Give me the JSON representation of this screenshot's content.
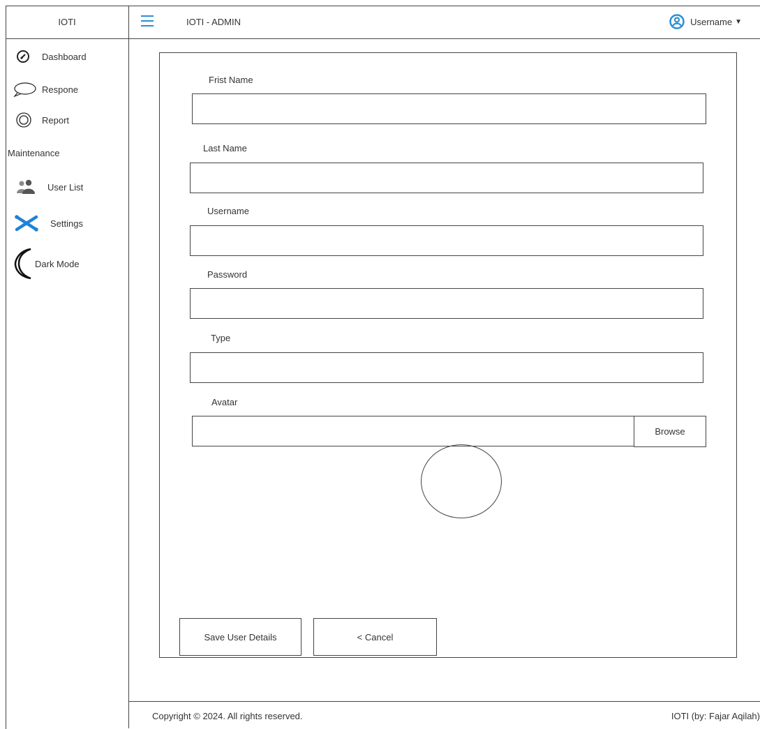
{
  "brand": "IOTI",
  "header": {
    "title": "IOTI - ADMIN",
    "username": "Username",
    "accent": "#2a8fd6"
  },
  "sidebar": {
    "items": [
      {
        "label": "Dashboard",
        "icon": "speedometer-icon"
      },
      {
        "label": "Respone",
        "icon": "speech-bubble-icon"
      },
      {
        "label": "Report",
        "icon": "target-circle-icon"
      }
    ],
    "section": "Maintenance",
    "maintenance_items": [
      {
        "label": "User List",
        "icon": "users-icon"
      },
      {
        "label": "Settings",
        "icon": "cross-tools-icon"
      },
      {
        "label": "Dark Mode",
        "icon": "crescent-moon-icon"
      }
    ]
  },
  "form": {
    "first_name_label": "Frist Name",
    "last_name_label": "Last Name",
    "username_label": "Username",
    "password_label": "Password",
    "type_label": "Type",
    "avatar_label": "Avatar",
    "browse_label": "Browse",
    "save_label": "Save User Details",
    "cancel_label": "< Cancel"
  },
  "footer": {
    "copyright": "Copyright © 2024. All rights reserved.",
    "credit": "IOTI (by: Fajar Aqilah)"
  }
}
